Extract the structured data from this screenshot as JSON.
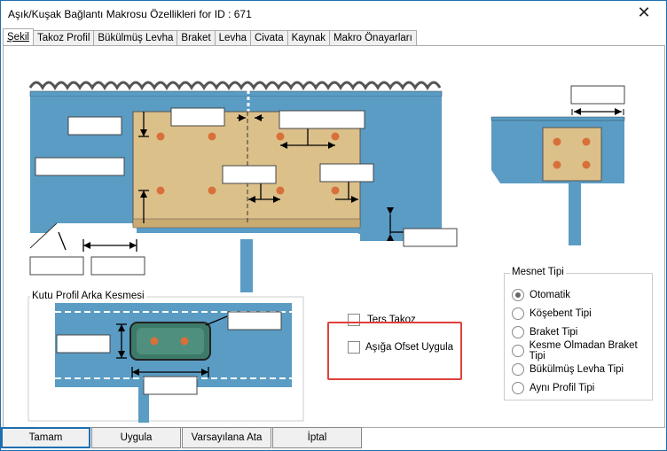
{
  "window": {
    "title": "Aşık/Kuşak Bağlantı Makrosu Özellikleri for ID : 671",
    "close_glyph": "✕"
  },
  "tabs": [
    {
      "label": "Şekil",
      "active": true
    },
    {
      "label": "Takoz Profil",
      "active": false
    },
    {
      "label": "Bükülmüş Levha",
      "active": false
    },
    {
      "label": "Braket",
      "active": false
    },
    {
      "label": "Levha",
      "active": false
    },
    {
      "label": "Civata",
      "active": false
    },
    {
      "label": "Kaynak",
      "active": false
    },
    {
      "label": "Makro Önayarları",
      "active": false
    }
  ],
  "box_section": {
    "title": "Kutu Profil Arka Kesmesi"
  },
  "options": {
    "ters_takoz": {
      "label": "Ters Takoz",
      "checked": false
    },
    "asiga_ofset": {
      "label": "Aşığa Ofset Uygula",
      "checked": false
    }
  },
  "support_type": {
    "title": "Mesnet Tipi",
    "items": [
      {
        "label": "Otomatik",
        "checked": true
      },
      {
        "label": "Köşebent Tipi",
        "checked": false
      },
      {
        "label": "Braket Tipi",
        "checked": false
      },
      {
        "label": "Kesme Olmadan Braket Tipi",
        "checked": false
      },
      {
        "label": "Bükülmüş Levha Tipi",
        "checked": false
      },
      {
        "label": "Aynı Profil Tipi",
        "checked": false
      }
    ]
  },
  "buttons": {
    "ok": "Tamam",
    "apply": "Uygula",
    "defaults": "Varsayılana Ata",
    "cancel": "İptal"
  },
  "colors": {
    "steel_blue": "#5a9cc4",
    "plate_tan": "#dcc08a",
    "bolt_orange": "#d8703a",
    "highlight_red": "#e0403a",
    "accent_blue": "#1f6fb0"
  }
}
